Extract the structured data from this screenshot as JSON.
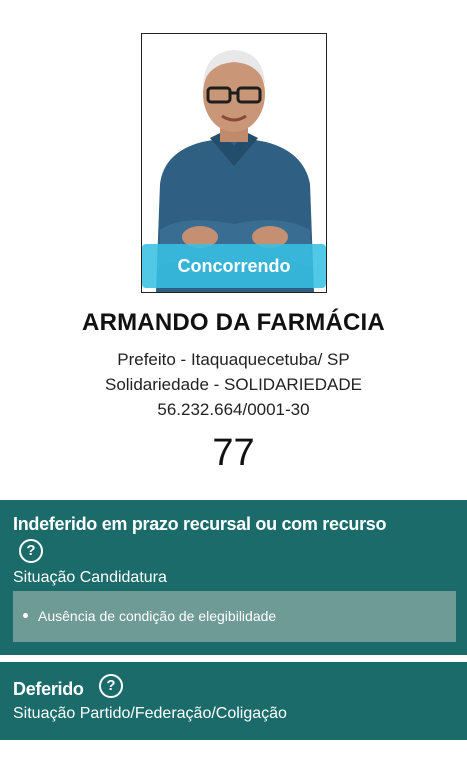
{
  "candidate": {
    "status_ribbon": "Concorrendo",
    "name": "ARMANDO DA FARMÁCIA",
    "office": "Prefeito - Itaquaquecetuba/ SP",
    "party": "Solidariedade - SOLIDARIEDADE",
    "cnpj": "56.232.664/0001-30",
    "number": "77"
  },
  "candidacy_panel": {
    "title": "Indeferido em prazo recursal ou com recurso",
    "help_glyph": "?",
    "subtitle": "Situação Candidatura",
    "reasons": [
      "Ausência de condição de elegibilidade"
    ]
  },
  "party_panel": {
    "title": "Deferido",
    "help_glyph": "?",
    "subtitle": "Situação Partido/Federação/Coligação"
  },
  "colors": {
    "panel_background": "#1b6b6b",
    "reasons_background": "#6f9b97",
    "ribbon": "#38c0e2"
  }
}
